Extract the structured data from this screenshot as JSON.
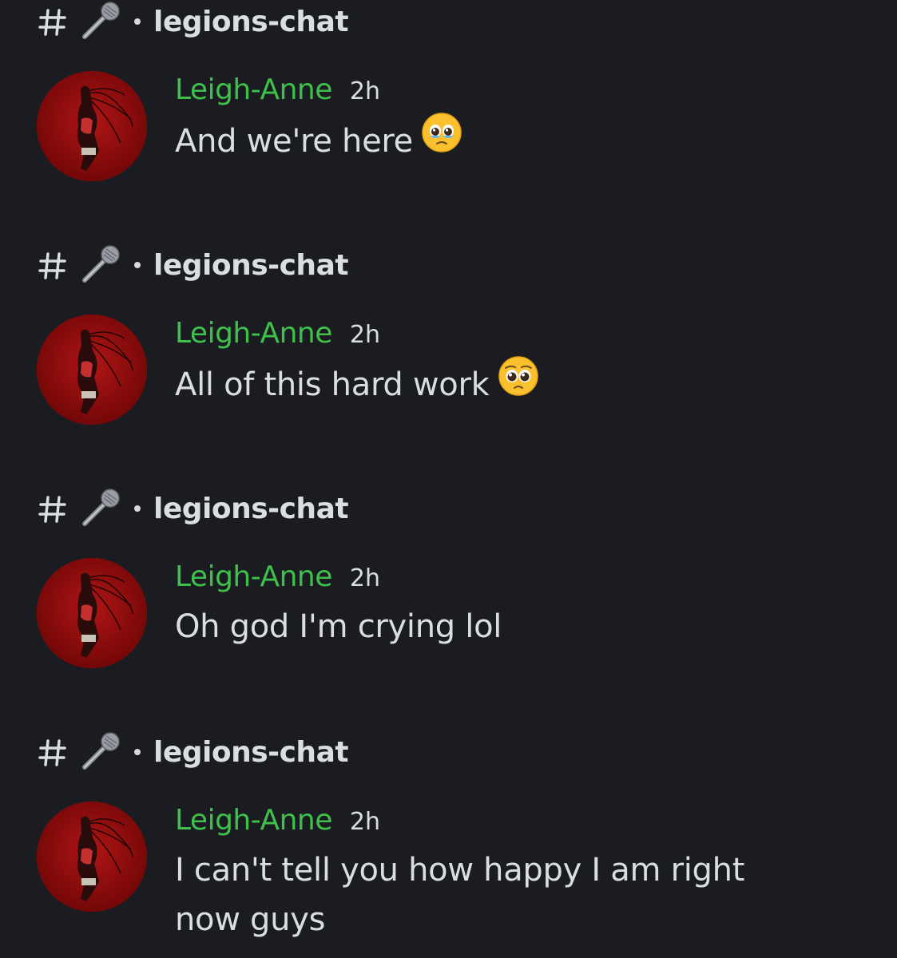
{
  "channel": {
    "name": "legions-chat",
    "hash_icon": "hash-icon",
    "channel_emoji": "microphone-icon"
  },
  "colors": {
    "background": "#1b1c21",
    "username": "#3ec04b",
    "text": "#dbdee1",
    "avatar_bg": "#8e0a0a"
  },
  "messages": [
    {
      "channel": "legions-chat",
      "author": "Leigh-Anne",
      "time": "2h",
      "text": "And we're here",
      "emoji": "face-holding-back-tears"
    },
    {
      "channel": "legions-chat",
      "author": "Leigh-Anne",
      "time": "2h",
      "text": "All of this hard work",
      "emoji": "pleading-face"
    },
    {
      "channel": "legions-chat",
      "author": "Leigh-Anne",
      "time": "2h",
      "text": "Oh god I'm crying lol",
      "emoji": ""
    },
    {
      "channel": "legions-chat",
      "author": "Leigh-Anne",
      "time": "2h",
      "text": "I can't tell you how happy I am right now guys",
      "emoji": ""
    }
  ]
}
